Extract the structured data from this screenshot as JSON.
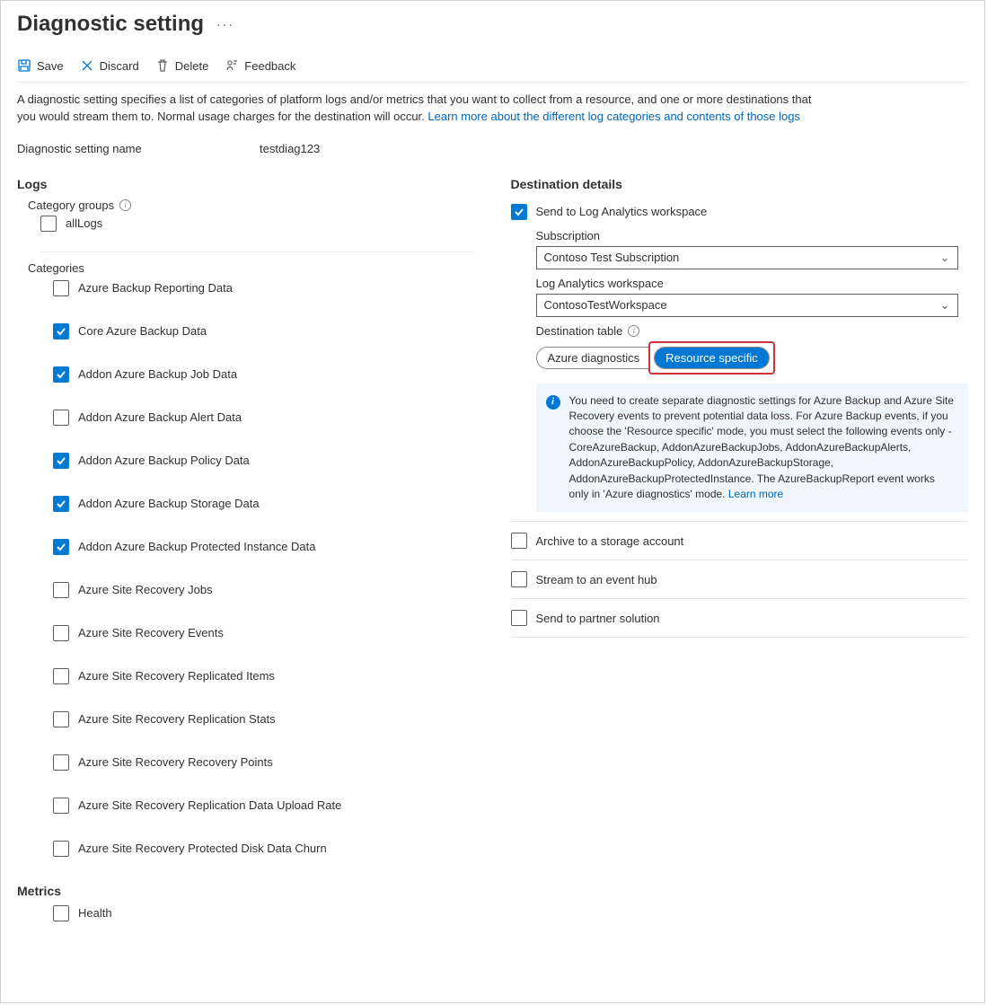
{
  "header": {
    "title": "Diagnostic setting"
  },
  "toolbar": {
    "save": "Save",
    "discard": "Discard",
    "delete": "Delete",
    "feedback": "Feedback"
  },
  "description": {
    "text": "A diagnostic setting specifies a list of categories of platform logs and/or metrics that you want to collect from a resource, and one or more destinations that you would stream them to. Normal usage charges for the destination will occur. ",
    "link": "Learn more about the different log categories and contents of those logs"
  },
  "name_field": {
    "label": "Diagnostic setting name",
    "value": "testdiag123"
  },
  "logs": {
    "title": "Logs",
    "category_groups_label": "Category groups",
    "groups": [
      {
        "label": "allLogs",
        "checked": false
      }
    ],
    "categories_label": "Categories",
    "categories": [
      {
        "label": "Azure Backup Reporting Data",
        "checked": false
      },
      {
        "label": "Core Azure Backup Data",
        "checked": true
      },
      {
        "label": "Addon Azure Backup Job Data",
        "checked": true
      },
      {
        "label": "Addon Azure Backup Alert Data",
        "checked": false
      },
      {
        "label": "Addon Azure Backup Policy Data",
        "checked": true
      },
      {
        "label": "Addon Azure Backup Storage Data",
        "checked": true
      },
      {
        "label": "Addon Azure Backup Protected Instance Data",
        "checked": true
      },
      {
        "label": "Azure Site Recovery Jobs",
        "checked": false
      },
      {
        "label": "Azure Site Recovery Events",
        "checked": false
      },
      {
        "label": "Azure Site Recovery Replicated Items",
        "checked": false
      },
      {
        "label": "Azure Site Recovery Replication Stats",
        "checked": false
      },
      {
        "label": "Azure Site Recovery Recovery Points",
        "checked": false
      },
      {
        "label": "Azure Site Recovery Replication Data Upload Rate",
        "checked": false
      },
      {
        "label": "Azure Site Recovery Protected Disk Data Churn",
        "checked": false
      }
    ]
  },
  "metrics": {
    "title": "Metrics",
    "items": [
      {
        "label": "Health",
        "checked": false
      }
    ]
  },
  "destination": {
    "title": "Destination details",
    "log_analytics": {
      "label": "Send to Log Analytics workspace",
      "checked": true,
      "subscription_label": "Subscription",
      "subscription_value": "Contoso Test Subscription",
      "workspace_label": "Log Analytics workspace",
      "workspace_value": "ContosoTestWorkspace",
      "table_label": "Destination table",
      "table_options": {
        "a": "Azure diagnostics",
        "b": "Resource specific"
      },
      "info_text": "You need to create separate diagnostic settings for Azure Backup and Azure Site Recovery events to prevent potential data loss. For Azure Backup events, if you choose the 'Resource specific' mode, you must select the following events only - CoreAzureBackup, AddonAzureBackupJobs, AddonAzureBackupAlerts, AddonAzureBackupPolicy, AddonAzureBackupStorage, AddonAzureBackupProtectedInstance. The AzureBackupReport event works only in 'Azure diagnostics' mode.  ",
      "info_link": "Learn more"
    },
    "storage": {
      "label": "Archive to a storage account",
      "checked": false
    },
    "eventhub": {
      "label": "Stream to an event hub",
      "checked": false
    },
    "partner": {
      "label": "Send to partner solution",
      "checked": false
    }
  }
}
